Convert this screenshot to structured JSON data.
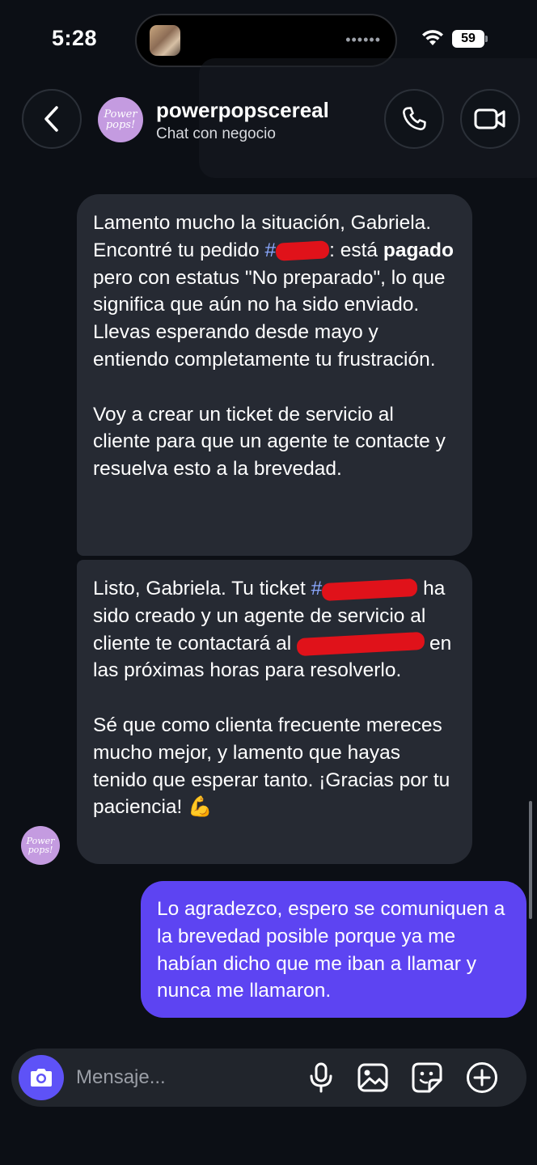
{
  "status_bar": {
    "time": "5:28",
    "battery": "59",
    "island_dots": "••••••"
  },
  "header": {
    "avatar_text": "Power pops!",
    "name": "powerpopscereal",
    "subtitle": "Chat con negocio"
  },
  "messages": [
    {
      "from": "business",
      "paragraphs": [
        {
          "part1": "Lamento mucho la situación, Gabriela. Encontré tu pedido ",
          "ref": "#",
          "part2": ": está ",
          "bold": "pagado",
          "part3": " pero con estatus \"No preparado\", lo que significa que aún no ha sido enviado. Llevas esperando desde mayo y entiendo completamente tu frustración."
        },
        {
          "text": "Voy a crear un ticket de servicio al cliente para que un agente te contacte y resuelva esto a la brevedad."
        }
      ]
    },
    {
      "from": "business",
      "paragraphs": [
        {
          "part1": "Listo, Gabriela. Tu ticket ",
          "ref": "#",
          "part2": " ha sido creado y un agente de servicio al cliente te contactará al ",
          "part3": "en las próximas horas para resolverlo."
        },
        {
          "text": "Sé que como clienta frecuente mereces mucho mejor, y lamento que hayas tenido que esperar tanto. ¡Gracias por tu paciencia! 💪"
        }
      ]
    },
    {
      "from": "user",
      "text": "Lo agradezco, espero se comuniquen a la brevedad posible porque ya me habían dicho que me iban a llamar y nunca me llamaron."
    }
  ],
  "composer": {
    "placeholder": "Mensaje..."
  },
  "colors": {
    "background": "#0c0f15",
    "incoming_bubble": "#262a33",
    "outgoing_bubble": "#5d44f2",
    "link": "#8ba8ff",
    "redaction": "#e0121a",
    "avatar": "#c49be0",
    "camera_button": "#5e52f7"
  },
  "icons": [
    "wifi-icon",
    "battery-icon",
    "back-chevron-icon",
    "phone-icon",
    "video-camera-icon",
    "camera-icon",
    "microphone-icon",
    "image-icon",
    "sticker-icon",
    "plus-circle-icon",
    "flexed-biceps-emoji"
  ]
}
